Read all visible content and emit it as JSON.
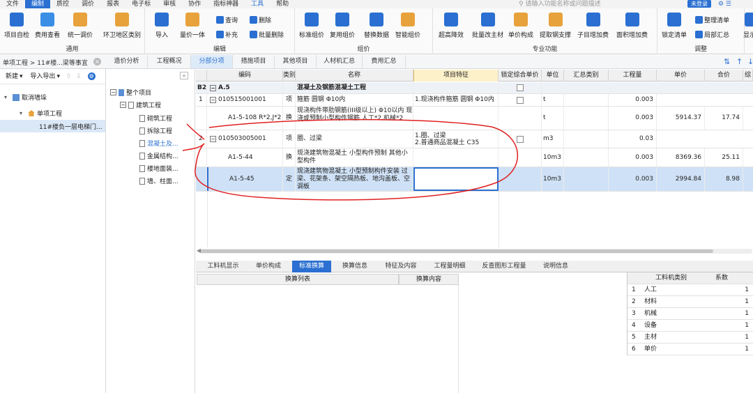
{
  "menu": {
    "items": [
      "文件",
      "编制",
      "质控",
      "调价",
      "报表",
      "电子标",
      "审核",
      "协作",
      "指标神器",
      "工具",
      "帮助"
    ],
    "search_placeholder": "请输入功能名称或问题描述",
    "login": "未登录"
  },
  "ribbon": {
    "groups": {
      "general": "通用",
      "edit": "编辑",
      "price": "组价",
      "special": "专业功能",
      "adjust": "调整"
    },
    "buttons": {
      "self_check": "项目自检",
      "fee_view": "费用查看",
      "unify_price": "统一调价",
      "env_sanitation": "环卫地区类别",
      "import": "导入",
      "price_one": "量价一体",
      "query": "查询",
      "supplement": "补充",
      "delete": "删除",
      "batch_delete": "批量删除",
      "standard_price": "标准组价",
      "reuse_price": "复用组价",
      "replace_data": "替换数据",
      "smart_price": "智能组价",
      "super_reduce": "超高降效",
      "batch_main_material": "批量改主材",
      "unit_composition": "单价构成",
      "extract_support": "提取钢支撑",
      "sub_item_add": "子目增加费",
      "area_add": "面积增加费",
      "lock_list": "锁定清单",
      "organize_list": "整理清单",
      "local_summary": "局部汇总",
      "display": "显示"
    }
  },
  "breadcrumb": "单项工程 > 11#楼...梁等事宜",
  "tabs": [
    "造价分析",
    "工程概况",
    "分部分项",
    "措施项目",
    "其他项目",
    "人材机汇总",
    "费用汇总"
  ],
  "left_panel": {
    "new": "新建",
    "import_export": "导入导出",
    "root": "取消墙垛",
    "child": "单项工程",
    "leaf": "11#楼负一层电梯门..."
  },
  "tree": {
    "root": "整个项目",
    "building": "建筑工程",
    "items": [
      "砌筑工程",
      "拆除工程",
      "混凝土及...",
      "金属结构...",
      "楼地面装...",
      "墙、柱面..."
    ]
  },
  "grid": {
    "headers": [
      "编码",
      "类别",
      "名称",
      "项目特征",
      "锁定综合单价",
      "单位",
      "汇总类别",
      "工程量",
      "单价",
      "合价",
      "综"
    ],
    "rows": [
      {
        "no": "B2",
        "code": "A.5",
        "type": "",
        "name": "混凝土及钢筋混凝土工程",
        "feature": "",
        "unit": "",
        "qty": "",
        "price": "",
        "total": ""
      },
      {
        "no": "1",
        "code": "010515001001",
        "type": "项",
        "name": "箍筋 圆钢 Φ10内",
        "feature": "1.现浇构件箍筋 圆钢 Φ10内",
        "unit": "t",
        "qty": "0.003",
        "price": "",
        "total": ""
      },
      {
        "no": "",
        "code": "A1-5-108 R*2,J*2",
        "type": "换",
        "name": "现浇构件带肋钢筋(III级以上) Φ10以内 现浇或预制小型构件钢筋 人工*2,机械*2",
        "feature": "",
        "unit": "t",
        "qty": "0.003",
        "price": "5914.37",
        "total": "17.74"
      },
      {
        "no": "2",
        "code": "010503005001",
        "type": "项",
        "name": "圈、过梁",
        "feature": "1.圈、过梁\n2.普通商品混凝土 C35",
        "unit": "m3",
        "qty": "0.03",
        "price": "",
        "total": ""
      },
      {
        "no": "",
        "code": "A1-5-44",
        "type": "换",
        "name": "现浇建筑物混凝土 小型构件预制 其他小型构件",
        "feature": "",
        "unit": "10m3",
        "qty": "0.003",
        "price": "8369.36",
        "total": "25.11"
      },
      {
        "no": "",
        "code": "A1-5-45",
        "type": "定",
        "name": "现浇建筑物混凝土 小型预制构件安装 过梁、花架条、架空隔热板、地沟盖板、空调板",
        "feature": "",
        "unit": "10m3",
        "qty": "0.003",
        "price": "2994.84",
        "total": "8.98"
      }
    ]
  },
  "bottom": {
    "tabs": [
      "工料机显示",
      "单价构成",
      "标准换算",
      "换算信息",
      "特征及内容",
      "工程量明细",
      "反查图形工程量",
      "说明信息"
    ],
    "list_header": "换算列表",
    "content_header": "换算内容",
    "type_header": "工料机类别",
    "coef_header": "系数",
    "types": [
      {
        "no": "1",
        "name": "人工",
        "coef": "1"
      },
      {
        "no": "2",
        "name": "材料",
        "coef": "1"
      },
      {
        "no": "3",
        "name": "机械",
        "coef": "1"
      },
      {
        "no": "4",
        "name": "设备",
        "coef": "1"
      },
      {
        "no": "5",
        "name": "主材",
        "coef": "1"
      },
      {
        "no": "6",
        "name": "单价",
        "coef": "1"
      }
    ]
  },
  "colors": {
    "accent": "#2a6fd1",
    "selected_row": "#cfe1f6",
    "annotation": "#e02020"
  }
}
